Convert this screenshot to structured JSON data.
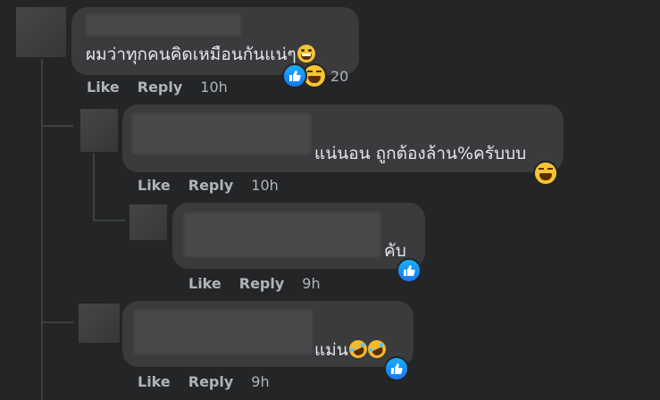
{
  "comments": [
    {
      "text": "ผมว่าทุกคนคิดเหมือนกันแน่ๆ",
      "emoji": [
        "grin-icon"
      ],
      "reactions": {
        "types": [
          "like",
          "haha"
        ],
        "count": "20"
      },
      "actions": {
        "like": "Like",
        "reply": "Reply",
        "time": "10h"
      }
    },
    {
      "text": "แน่นอน ถูกต้องล้าน%ครับบบ",
      "emoji": [],
      "reactions": {
        "types": [
          "haha"
        ],
        "count": ""
      },
      "actions": {
        "like": "Like",
        "reply": "Reply",
        "time": "10h"
      }
    },
    {
      "text": "คับ",
      "emoji": [],
      "reactions": {
        "types": [
          "like"
        ],
        "count": ""
      },
      "actions": {
        "like": "Like",
        "reply": "Reply",
        "time": "9h"
      }
    },
    {
      "text": "แม่น",
      "emoji": [
        "rofl-icon",
        "rofl-icon"
      ],
      "reactions": {
        "types": [
          "like"
        ],
        "count": ""
      },
      "actions": {
        "like": "Like",
        "reply": "Reply",
        "time": "9h"
      }
    }
  ],
  "colors": {
    "background": "#242526",
    "bubble": "#3a3b3c",
    "text": "#e4e6eb",
    "meta": "#b0b3b8",
    "like": "#1877f2"
  }
}
